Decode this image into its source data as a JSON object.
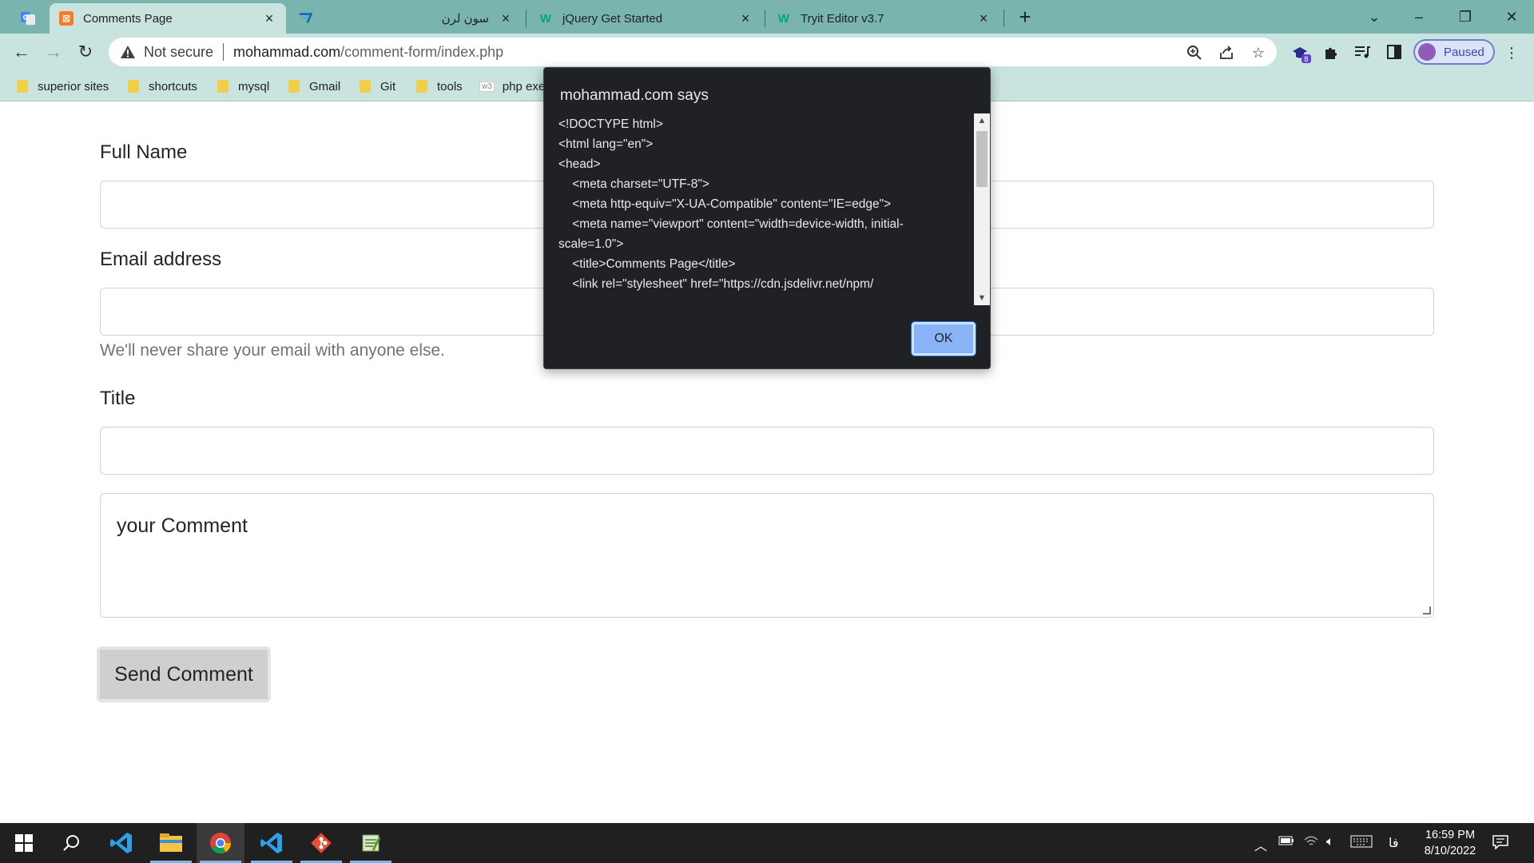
{
  "tabs": [
    {
      "title": "Comments Page",
      "active": true
    },
    {
      "title": "سون لرن",
      "active": false
    },
    {
      "title": "jQuery Get Started",
      "active": false
    },
    {
      "title": "Tryit Editor v3.7",
      "active": false
    }
  ],
  "address_bar": {
    "security_label": "Not secure",
    "url_host": "mohammad.com",
    "url_path": "/comment-form/index.php"
  },
  "extensions": {
    "badge_count": "8"
  },
  "profile": {
    "label": "Paused"
  },
  "bookmarks": [
    "superior sites",
    "shortcuts",
    "mysql",
    "Gmail",
    "Git",
    "tools",
    "php exe"
  ],
  "form": {
    "full_name_label": "Full Name",
    "full_name_value": "",
    "email_label": "Email address",
    "email_value": "",
    "email_help": "We'll never share your email with anyone else.",
    "title_label": "Title",
    "title_value": "",
    "comment_placeholder": "your Comment",
    "submit_label": "Send Comment"
  },
  "dialog": {
    "title": "mohammad.com says",
    "lines": [
      "<!DOCTYPE html>",
      "<html lang=\"en\">",
      "",
      "<head>",
      "    <meta charset=\"UTF-8\">",
      "    <meta http-equiv=\"X-UA-Compatible\" content=\"IE=edge\">",
      "    <meta name=\"viewport\" content=\"width=device-width, initial-",
      "scale=1.0\">",
      "    <title>Comments Page</title>",
      "    <link rel=\"stylesheet\" href=\"https://cdn.jsdelivr.net/npm/"
    ],
    "ok_label": "OK"
  },
  "taskbar": {
    "apps": [
      "start",
      "search",
      "vscode",
      "file-explorer",
      "chrome",
      "vscode",
      "git",
      "notepad"
    ],
    "language": "فا",
    "time": "16:59 PM",
    "date": "8/10/2022"
  },
  "colors": {
    "tabstrip": "#79b5ae",
    "toolbar": "#c9e3df",
    "dialog_bg": "#202124",
    "ok_button": "#8ab4f8",
    "button_gray": "#cfcfcf"
  }
}
